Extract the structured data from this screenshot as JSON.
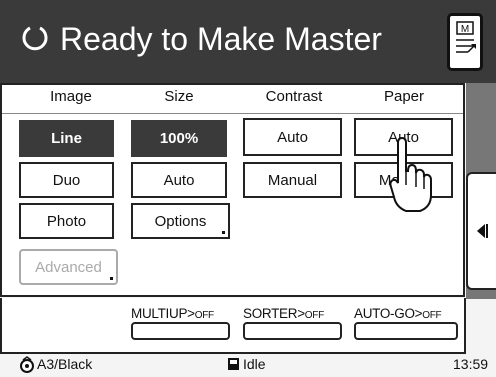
{
  "header": {
    "title": "Ready to Make Master",
    "menu_icon_letter": "M"
  },
  "columns": [
    {
      "label": "Image"
    },
    {
      "label": "Size"
    },
    {
      "label": "Contrast"
    },
    {
      "label": "Paper"
    }
  ],
  "image_options": [
    "Line",
    "Duo",
    "Photo",
    "Advanced"
  ],
  "size_options": [
    "100%",
    "Auto",
    "Options"
  ],
  "contrast_options": [
    "Auto",
    "Manual"
  ],
  "paper_options": [
    "Auto",
    "Manual"
  ],
  "modes": {
    "multiup": {
      "name": "MULTIUP>",
      "state": "OFF"
    },
    "sorter": {
      "name": "SORTER>",
      "state": "OFF"
    },
    "autogo": {
      "name": "AUTO-GO>",
      "state": "OFF"
    }
  },
  "footer": {
    "paper_color": "A3/Black",
    "status": "Idle",
    "time": "13:59"
  },
  "colors": {
    "dark": "#3a3a3a",
    "sidebar": "#777777",
    "disabled": "#aaaaaa"
  },
  "icons": [
    "refresh-icon",
    "menu-icon",
    "collapse-arrow-icon",
    "finger-pointer-icon",
    "drum-icon",
    "stop-icon"
  ]
}
